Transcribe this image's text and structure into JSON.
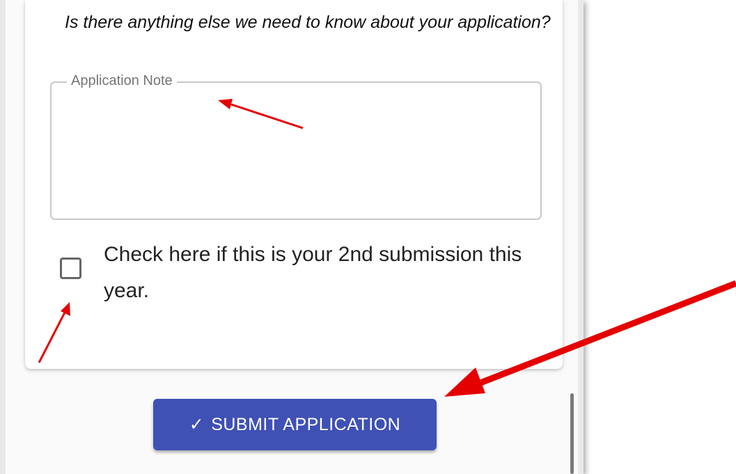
{
  "form": {
    "question": "Is there anything else we need to know about your application?",
    "note_field": {
      "label": "Application Note",
      "value": ""
    },
    "second_submission": {
      "label": "Check here if this is your 2nd submission this year.",
      "checked": false
    },
    "submit_label": "SUBMIT APPLICATION",
    "submit_icon": "checkmark-icon"
  },
  "annotations": {
    "arrow_color": "#e50000"
  },
  "colors": {
    "primary": "#3f51b5",
    "text": "#222222",
    "border": "#c8c8c8"
  }
}
